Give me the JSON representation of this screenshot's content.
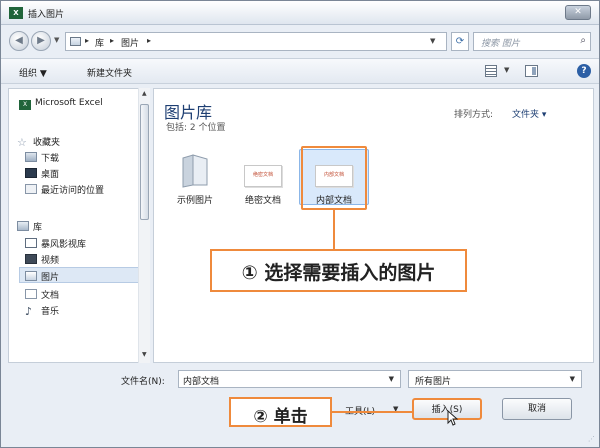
{
  "window": {
    "title": "插入图片",
    "app_icon_text": "X",
    "close_label": "✕"
  },
  "address": {
    "crumbs": [
      "库",
      "图片"
    ],
    "search_placeholder": "搜索 图片"
  },
  "toolbar": {
    "organize": "组织 ▼",
    "new_folder": "新建文件夹"
  },
  "nav": {
    "items": [
      {
        "label": "Microsoft Excel",
        "icon": "excel-icon"
      },
      {
        "label": "收藏夹",
        "icon": "star-icon"
      },
      {
        "label": "下载",
        "icon": "download-folder-icon"
      },
      {
        "label": "桌面",
        "icon": "desktop-icon"
      },
      {
        "label": "最近访问的位置",
        "icon": "recent-places-icon"
      },
      {
        "label": "库",
        "icon": "library-icon"
      },
      {
        "label": "暴风影视库",
        "icon": "video-library-icon"
      },
      {
        "label": "视频",
        "icon": "video-icon"
      },
      {
        "label": "图片",
        "icon": "pictures-icon"
      },
      {
        "label": "文档",
        "icon": "documents-icon"
      },
      {
        "label": "音乐",
        "icon": "music-icon"
      }
    ]
  },
  "content": {
    "library_title": "图片库",
    "library_subtitle": "包括: 2 个位置",
    "sort_label": "排列方式:",
    "sort_value": "文件夹 ▾",
    "items": [
      {
        "label": "示例图片",
        "type": "folder"
      },
      {
        "label": "绝密文档",
        "type": "document",
        "thumb_text": "绝密文档"
      },
      {
        "label": "内部文档",
        "type": "document",
        "thumb_text": "内部文档",
        "selected": true
      }
    ]
  },
  "callouts": {
    "step1": "① 选择需要插入的图片",
    "step2": "② 单击"
  },
  "footer": {
    "filename_label": "文件名(N):",
    "filename_value": "内部文档",
    "filetype_value": "所有图片",
    "tools_label": "工具(L)",
    "insert_label": "插入(S)",
    "cancel_label": "取消"
  },
  "colors": {
    "accent_orange": "#ef8a3c",
    "library_title_blue": "#1e3f73"
  }
}
